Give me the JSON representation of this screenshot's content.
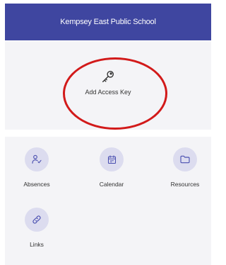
{
  "header": {
    "title": "Kempsey East Public School"
  },
  "access_key": {
    "label": "Add Access Key",
    "icon": "key-icon"
  },
  "tiles": [
    {
      "label": "Absences",
      "icon": "person-check-icon"
    },
    {
      "label": "Calendar",
      "icon": "calendar-icon"
    },
    {
      "label": "Resources",
      "icon": "folder-icon"
    },
    {
      "label": "Links",
      "icon": "link-icon"
    }
  ],
  "colors": {
    "header": "#3f46a0",
    "accent": "#4a4fb0",
    "highlight_ring": "#d21a1a",
    "tile_icon_bg": "#dcdcef"
  }
}
